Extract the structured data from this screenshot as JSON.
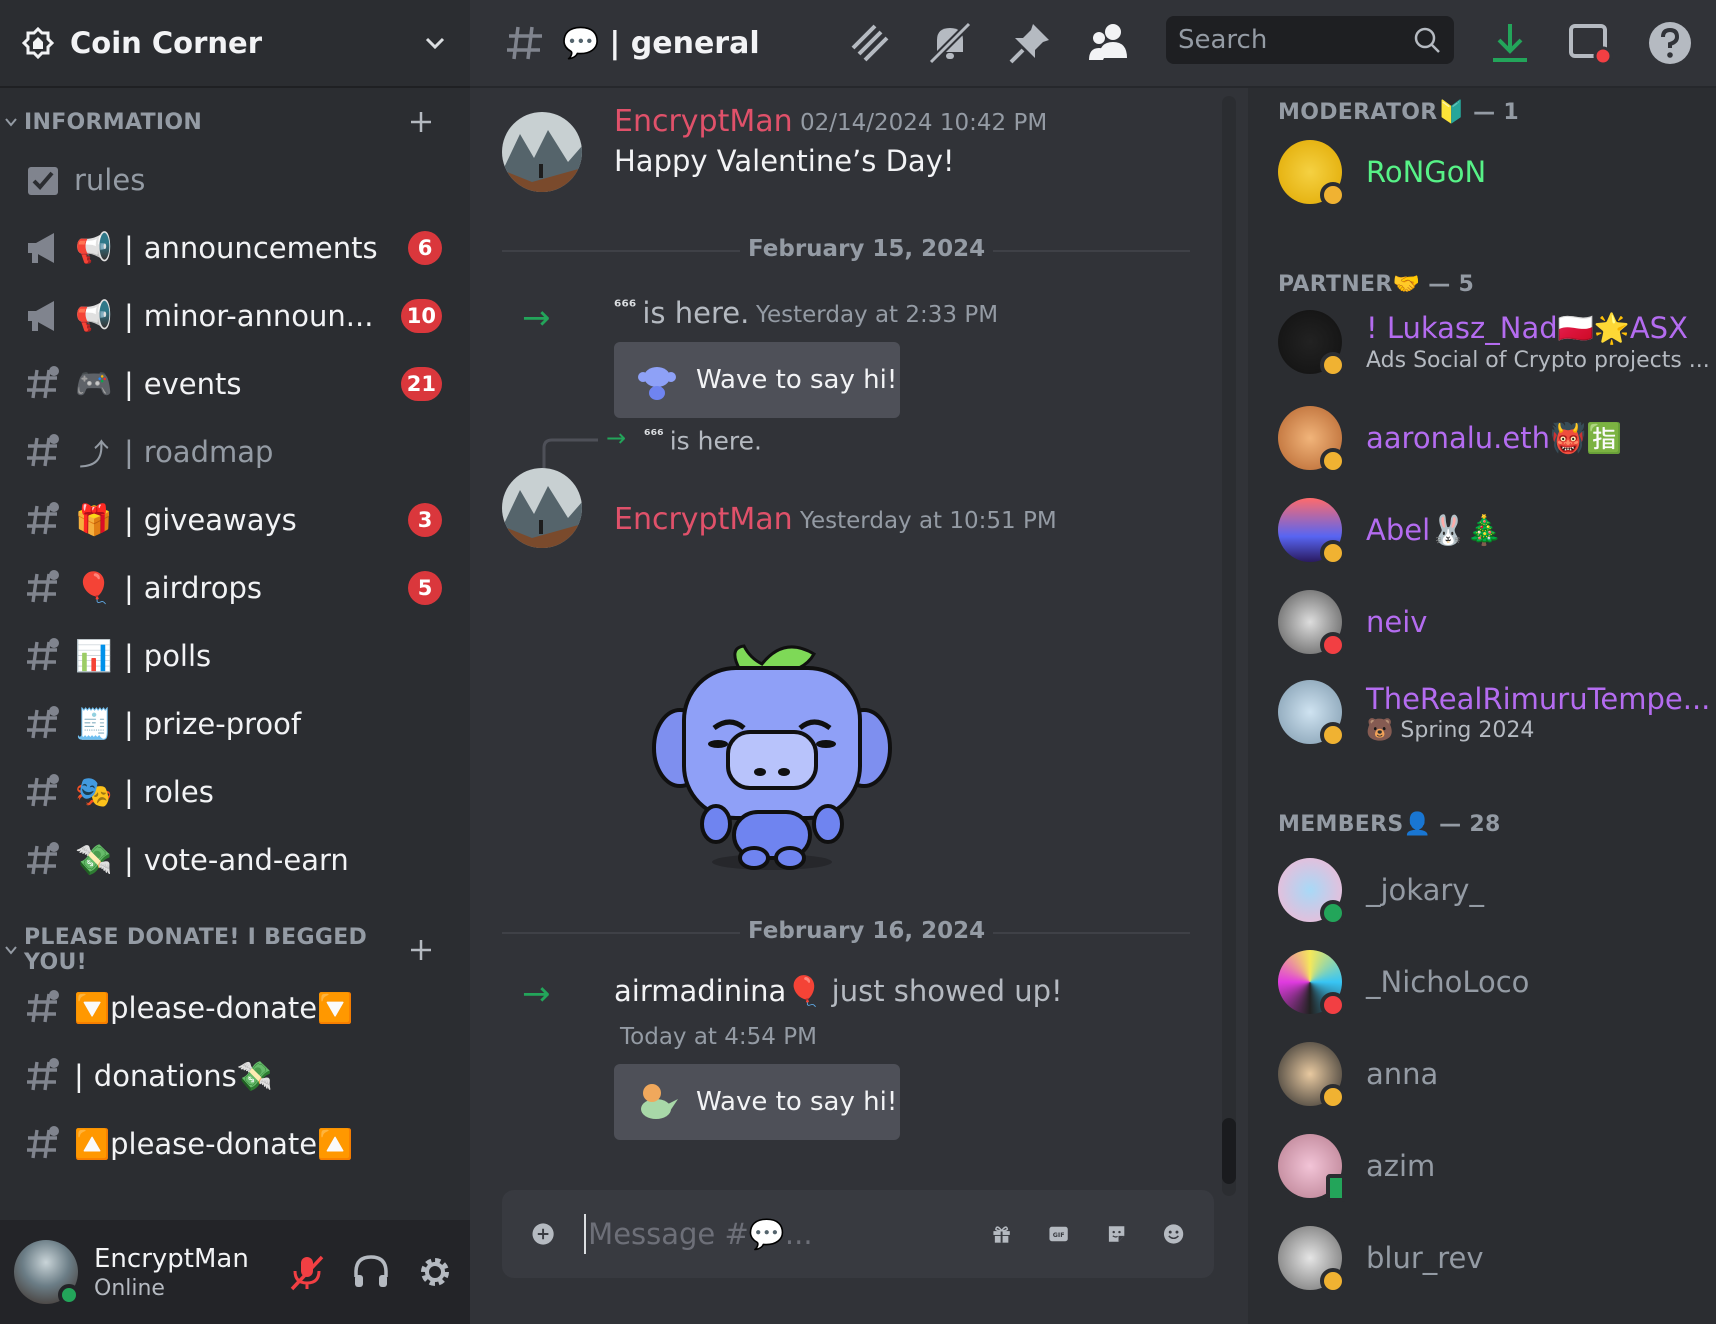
{
  "server": {
    "name": "Coin Corner"
  },
  "categories": [
    {
      "name": "INFORMATION"
    },
    {
      "name": "PLEASE DONATE! I BEGGED YOU!"
    }
  ],
  "channels": [
    {
      "name": "rules",
      "emoji": "",
      "badge": "",
      "muted": true
    },
    {
      "name": "announcements",
      "emoji": "📢",
      "badge": "6",
      "muted": false
    },
    {
      "name": "minor-announ...",
      "emoji": "📢",
      "badge": "10",
      "muted": false
    },
    {
      "name": "events",
      "emoji": "🎮",
      "badge": "21",
      "muted": false
    },
    {
      "name": "roadmap",
      "emoji": "⤴",
      "badge": "",
      "muted": true
    },
    {
      "name": "giveaways",
      "emoji": "🎁",
      "badge": "3",
      "muted": false
    },
    {
      "name": "airdrops",
      "emoji": "🎈",
      "badge": "5",
      "muted": false
    },
    {
      "name": "polls",
      "emoji": "📊",
      "badge": "",
      "muted": false
    },
    {
      "name": "prize-proof",
      "emoji": "🧾",
      "badge": "",
      "muted": false
    },
    {
      "name": "roles",
      "emoji": "🎭",
      "badge": "",
      "muted": false
    },
    {
      "name": "vote-and-earn",
      "emoji": "💸",
      "badge": "",
      "muted": false
    },
    {
      "name": "🔽please-donate🔽",
      "emoji": "",
      "badge": "",
      "muted": false
    },
    {
      "name": "donations💸",
      "emoji": "💸",
      "badge": "",
      "muted": false
    },
    {
      "name": "🔼please-donate🔼",
      "emoji": "",
      "badge": "",
      "muted": false
    }
  ],
  "user": {
    "name": "EncryptMan",
    "status": "Online"
  },
  "header": {
    "channel_emoji": "💬",
    "channel_name": "| general",
    "search_placeholder": "Search"
  },
  "messages": {
    "m1": {
      "author": "EncryptMan",
      "timestamp": "02/14/2024 10:42 PM",
      "text": "Happy Valentine’s Day!"
    },
    "divider1": "February 15, 2024",
    "join1": {
      "user": "⁶⁶⁶",
      "text": "is here.",
      "timestamp": "Yesterday at 2:33 PM"
    },
    "wave1": "Wave to say hi!",
    "reply": {
      "user": "⁶⁶⁶",
      "text": "is here."
    },
    "m2": {
      "author": "EncryptMan",
      "timestamp": "Yesterday at 10:51 PM"
    },
    "divider2": "February 16, 2024",
    "join2": {
      "user": "airmadinina🎈",
      "text": "just showed up!",
      "timestamp": "Today at 4:54 PM"
    },
    "wave2": "Wave to say hi!"
  },
  "composer": {
    "placeholder": "Message #💬..."
  },
  "member_groups": [
    {
      "label": "MODERATOR🔰 — 1"
    },
    {
      "label": "PARTNER🤝 — 5"
    },
    {
      "label": "MEMBERS👤 — 28"
    }
  ],
  "members": [
    {
      "name": "RoNGoN",
      "sub": "",
      "color": "#57f287",
      "status": "idle"
    },
    {
      "name": "! Lukasz_Nad🇵🇱🌟ASX",
      "sub": "Ads Social of Crypto projects ...",
      "color": "#b46cf0",
      "status": "idle"
    },
    {
      "name": "aaronalu.eth👹🈯",
      "sub": "",
      "color": "#b46cf0",
      "status": "idle"
    },
    {
      "name": "Abel🐰🎄",
      "sub": "",
      "color": "#b46cf0",
      "status": "idle"
    },
    {
      "name": "neiv",
      "sub": "",
      "color": "#b46cf0",
      "status": "dnd"
    },
    {
      "name": "TheRealRimuruTempe...",
      "sub": "🐻 Spring 2024",
      "color": "#b46cf0",
      "status": "idle"
    },
    {
      "name": "_jokary_",
      "sub": "",
      "color": "#949ba4",
      "status": "online"
    },
    {
      "name": "_NichoLoco",
      "sub": "",
      "color": "#949ba4",
      "status": "dnd"
    },
    {
      "name": "anna",
      "sub": "",
      "color": "#949ba4",
      "status": "idle"
    },
    {
      "name": "azim",
      "sub": "",
      "color": "#949ba4",
      "status": "mobile"
    },
    {
      "name": "blur_rev",
      "sub": "",
      "color": "#949ba4",
      "status": "idle"
    }
  ]
}
